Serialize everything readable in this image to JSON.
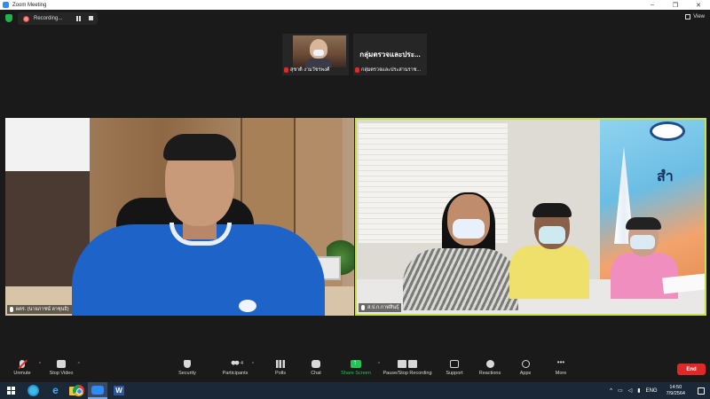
{
  "window": {
    "title": "Zoom Meeting",
    "controls": [
      "–",
      "❐",
      "✕"
    ]
  },
  "topbar": {
    "recording_label": "Recording...",
    "view_label": "View"
  },
  "thumbnails": [
    {
      "name": "สุชาติ งามวัชรพงศ์",
      "muted": true
    },
    {
      "name": "กลุ่มตรวจและประสานราช...",
      "display_name": "กลุ่มตรวจและประ...",
      "muted": true
    }
  ],
  "videos": {
    "left": {
      "name": "ผตร. (นายภาชน์ ลาชุนธิ)",
      "accent": "#1e64c8"
    },
    "right": {
      "name": "ส.ป.ก.กาฬสินธุ์",
      "poster_text": "สำ",
      "active_speaker_color": "#c6e04b"
    }
  },
  "toolbar": {
    "unmute": "Unmute",
    "stop_video": "Stop Video",
    "security": "Security",
    "participants": "Participants",
    "participants_count": "4",
    "polls": "Polls",
    "chat": "Chat",
    "share_screen": "Share Screen",
    "recording": "Pause/Stop Recording",
    "support": "Support",
    "reactions": "Reactions",
    "apps": "Apps",
    "more": "More",
    "end": "End",
    "end_color": "#e02828",
    "share_color": "#23c552"
  },
  "taskbar": {
    "language": "ENG",
    "time": "14:50",
    "date": "7/9/2564"
  }
}
